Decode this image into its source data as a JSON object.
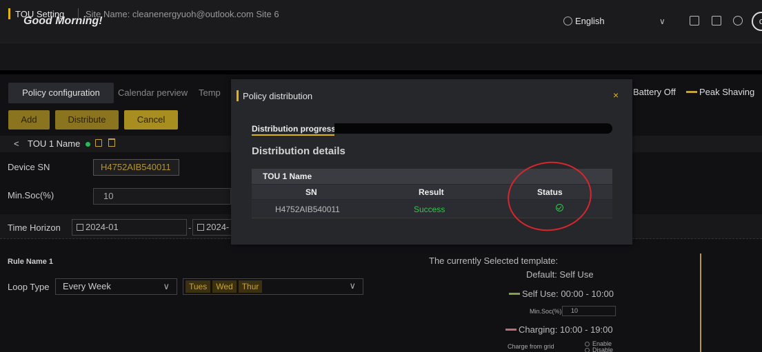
{
  "header": {
    "greeting": "Good Morning!",
    "language": "English",
    "avatar_letter": "c"
  },
  "breadcrumb": {
    "title": "TOU Setting",
    "site": "Site Name: cleanenergyuoh@outlook.com Site 6"
  },
  "tabs": [
    {
      "label": "Policy configuration"
    },
    {
      "label": "Calendar perview"
    },
    {
      "label": "Temp"
    }
  ],
  "legend": {
    "battery_off": "Battery Off",
    "peak_shaving": "Peak Shaving"
  },
  "toolbar": {
    "add": "Add",
    "distribute": "Distribute",
    "cancel": "Cancel"
  },
  "tou": {
    "back": "<",
    "name": "TOU 1 Name"
  },
  "form": {
    "device_sn_label": "Device SN",
    "device_sn_value": "H4752AIB540011",
    "min_soc_label": "Min.Soc(%)",
    "min_soc_value": "10",
    "time_horizon_label": "Time Horizon",
    "start": "2024-01",
    "separator": "-",
    "end": "2024-"
  },
  "rule": {
    "name": "Rule Name 1",
    "loop_label": "Loop Type",
    "loop_value": "Every Week",
    "days": [
      "Tues",
      "Wed",
      "Thur"
    ]
  },
  "template": {
    "title": "The currently Selected template:",
    "default": "Default: Self Use",
    "self_use": "Self Use: 00:00 - 10:00",
    "min_soc_label": "Min.Soc(%)",
    "min_soc_value": "10",
    "charging": "Charging: 10:00 - 19:00",
    "charge_from_grid": "Charge from grid",
    "enable": "Enable",
    "disable": "Disable"
  },
  "modal": {
    "title": "Policy distribution",
    "close": "×",
    "progress_label": "Distribution progress",
    "progress": 0,
    "details_label": "Distribution details",
    "group_name": "TOU 1 Name",
    "columns": [
      "SN",
      "Result",
      "Status"
    ],
    "rows": [
      {
        "sn": "H4752AIB540011",
        "result": "Success",
        "status": "success-check-icon"
      }
    ]
  },
  "colors": {
    "accent": "#e5b311",
    "success": "#34c74a",
    "annotation": "#d8262d"
  }
}
